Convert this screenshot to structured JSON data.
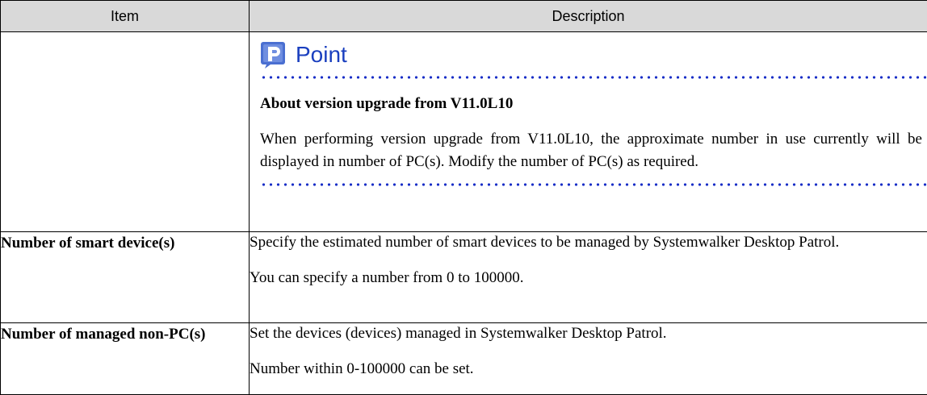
{
  "table": {
    "headers": {
      "item": "Item",
      "description": "Description"
    },
    "point": {
      "icon": "point-p-icon",
      "title": "Point",
      "subheading": "About version upgrade from V11.0L10",
      "body": "When performing version upgrade from V11.0L10, the approximate number in use currently will be displayed in number of PC(s). Modify the number of PC(s) as required."
    },
    "rows": [
      {
        "label": "Number of smart device(s)",
        "desc": [
          "Specify the estimated number of smart devices to be managed by Systemwalker Desktop Patrol.",
          "You can specify a number from 0 to 100000."
        ]
      },
      {
        "label": "Number of managed non-PC(s)",
        "desc": [
          "Set the devices (devices) managed in Systemwalker Desktop Patrol.",
          "Number within 0-100000 can be set."
        ]
      }
    ]
  },
  "colors": {
    "header_bg": "#d9d9d9",
    "point_blue": "#1a3fbf",
    "dot_blue": "#1a2fc7"
  }
}
